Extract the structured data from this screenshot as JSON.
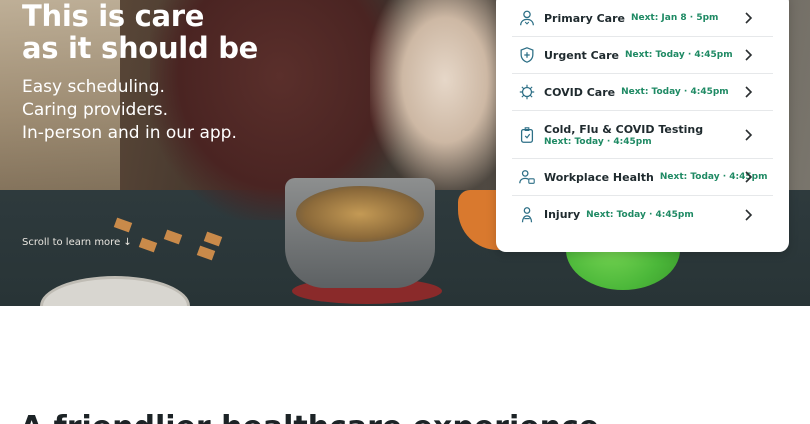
{
  "hero": {
    "title_line1": "This is care",
    "title_line2": "as it should be",
    "sub_line1": "Easy scheduling.",
    "sub_line2": "Caring providers.",
    "sub_line3": "In-person and in our app.",
    "scroll_link": "Scroll to learn more ↓"
  },
  "care_options": [
    {
      "label": "Primary Care",
      "next": "Next: Jan 8 · 5pm",
      "icon": "person-icon"
    },
    {
      "label": "Urgent Care",
      "next": "Next: Today · 4:45pm",
      "icon": "shield-cross-icon"
    },
    {
      "label": "COVID Care",
      "next": "Next: Today · 4:45pm",
      "icon": "virus-icon"
    },
    {
      "label": "Cold, Flu & COVID Testing",
      "next": "Next: Today · 4:45pm",
      "icon": "test-kit-icon"
    },
    {
      "label": "Workplace Health",
      "next": "Next: Today · 4:45pm",
      "icon": "worker-icon"
    },
    {
      "label": "Injury",
      "next": "Next: Today · 4:45pm",
      "icon": "injury-icon"
    }
  ],
  "section": {
    "heading": "A friendlier healthcare experience"
  },
  "colors": {
    "accent_green": "#1f8a64",
    "icon_teal": "#2d6f86",
    "text_dark": "#1f2a2e"
  }
}
